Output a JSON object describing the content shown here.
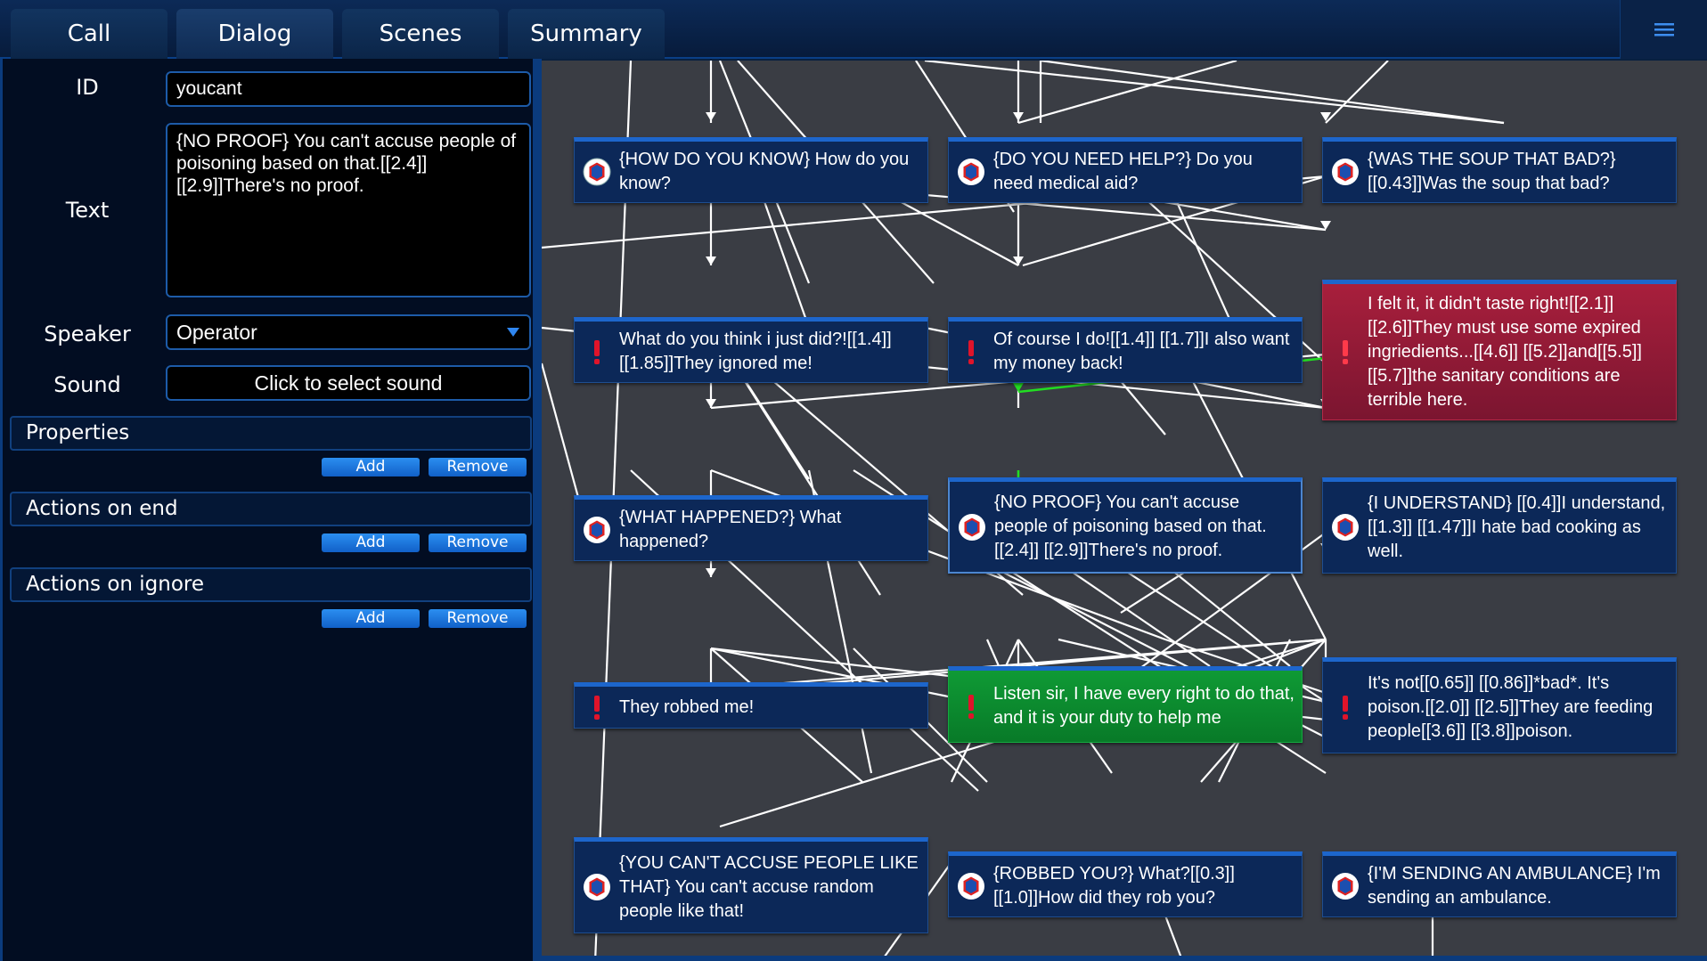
{
  "tabs": [
    {
      "label": "Call"
    },
    {
      "label": "Dialog"
    },
    {
      "label": "Scenes"
    },
    {
      "label": "Summary"
    }
  ],
  "active_tab": "Dialog",
  "form": {
    "id_label": "ID",
    "id_value": "youcant",
    "text_label": "Text",
    "text_value": "{NO PROOF} You can't accuse people of poisoning based on that.[[2.4]][[2.9]]There's no proof.",
    "speaker_label": "Speaker",
    "speaker_value": "Operator",
    "sound_label": "Sound",
    "sound_button": "Click to select sound"
  },
  "sections": [
    {
      "title": "Properties",
      "add": "Add",
      "remove": "Remove"
    },
    {
      "title": "Actions on end",
      "add": "Add",
      "remove": "Remove"
    },
    {
      "title": "Actions on ignore",
      "add": "Add",
      "remove": "Remove"
    }
  ],
  "nodes": [
    {
      "text": "{HOW DO YOU KNOW} How do you know?",
      "kind": "operator"
    },
    {
      "text": "{DO YOU NEED HELP?} Do you need medical aid?",
      "kind": "operator"
    },
    {
      "text": "{WAS THE SOUP THAT BAD?}[[0.43]]Was the soup that bad?",
      "kind": "operator"
    },
    {
      "text": "What do you think i just did?![[1.4]][[1.85]]They ignored me!",
      "kind": "caller"
    },
    {
      "text": "Of course I do![[1.4]] [[1.7]]I also want my money back!",
      "kind": "caller"
    },
    {
      "text": "I felt it, it didn't taste right![[2.1]][[2.6]]They must use some expired ingriedients...[[4.6]] [[5.2]]and[[5.5]][[5.7]]the sanitary conditions are terrible here.",
      "kind": "caller-red"
    },
    {
      "text": "{WHAT HAPPENED?} What happened?",
      "kind": "operator"
    },
    {
      "text": "{NO PROOF} You can't accuse people of poisoning based on that.[[2.4]] [[2.9]]There's no proof.",
      "kind": "operator-selected"
    },
    {
      "text": "{I UNDERSTAND} [[0.4]]I understand,[[1.3]] [[1.47]]I hate bad cooking as well.",
      "kind": "operator"
    },
    {
      "text": "They robbed me!",
      "kind": "caller"
    },
    {
      "text": "Listen sir, I have every right to do that, and it is your duty to help me",
      "kind": "caller-green"
    },
    {
      "text": "It's not[[0.65]] [[0.86]]*bad*. It's poison.[[2.0]] [[2.5]]They are feeding people[[3.6]] [[3.8]]poison.",
      "kind": "caller"
    },
    {
      "text": "{YOU CAN'T ACCUSE PEOPLE LIKE THAT} You can't accuse random people like that!",
      "kind": "operator"
    },
    {
      "text": "{ROBBED YOU?} What?[[0.3]][[1.0]]How did they rob you?",
      "kind": "operator"
    },
    {
      "text": "{I'M SENDING AN AMBULANCE} I'm sending an ambulance.",
      "kind": "operator"
    }
  ],
  "colors": {
    "edge": "#ffffff",
    "edge_active": "#22dd22",
    "canvas_bg": "#3a3d44",
    "node_bg": "#0c2858",
    "node_red": "#a81f3c",
    "node_green": "#0f9a35",
    "accent": "#1d66cc"
  }
}
